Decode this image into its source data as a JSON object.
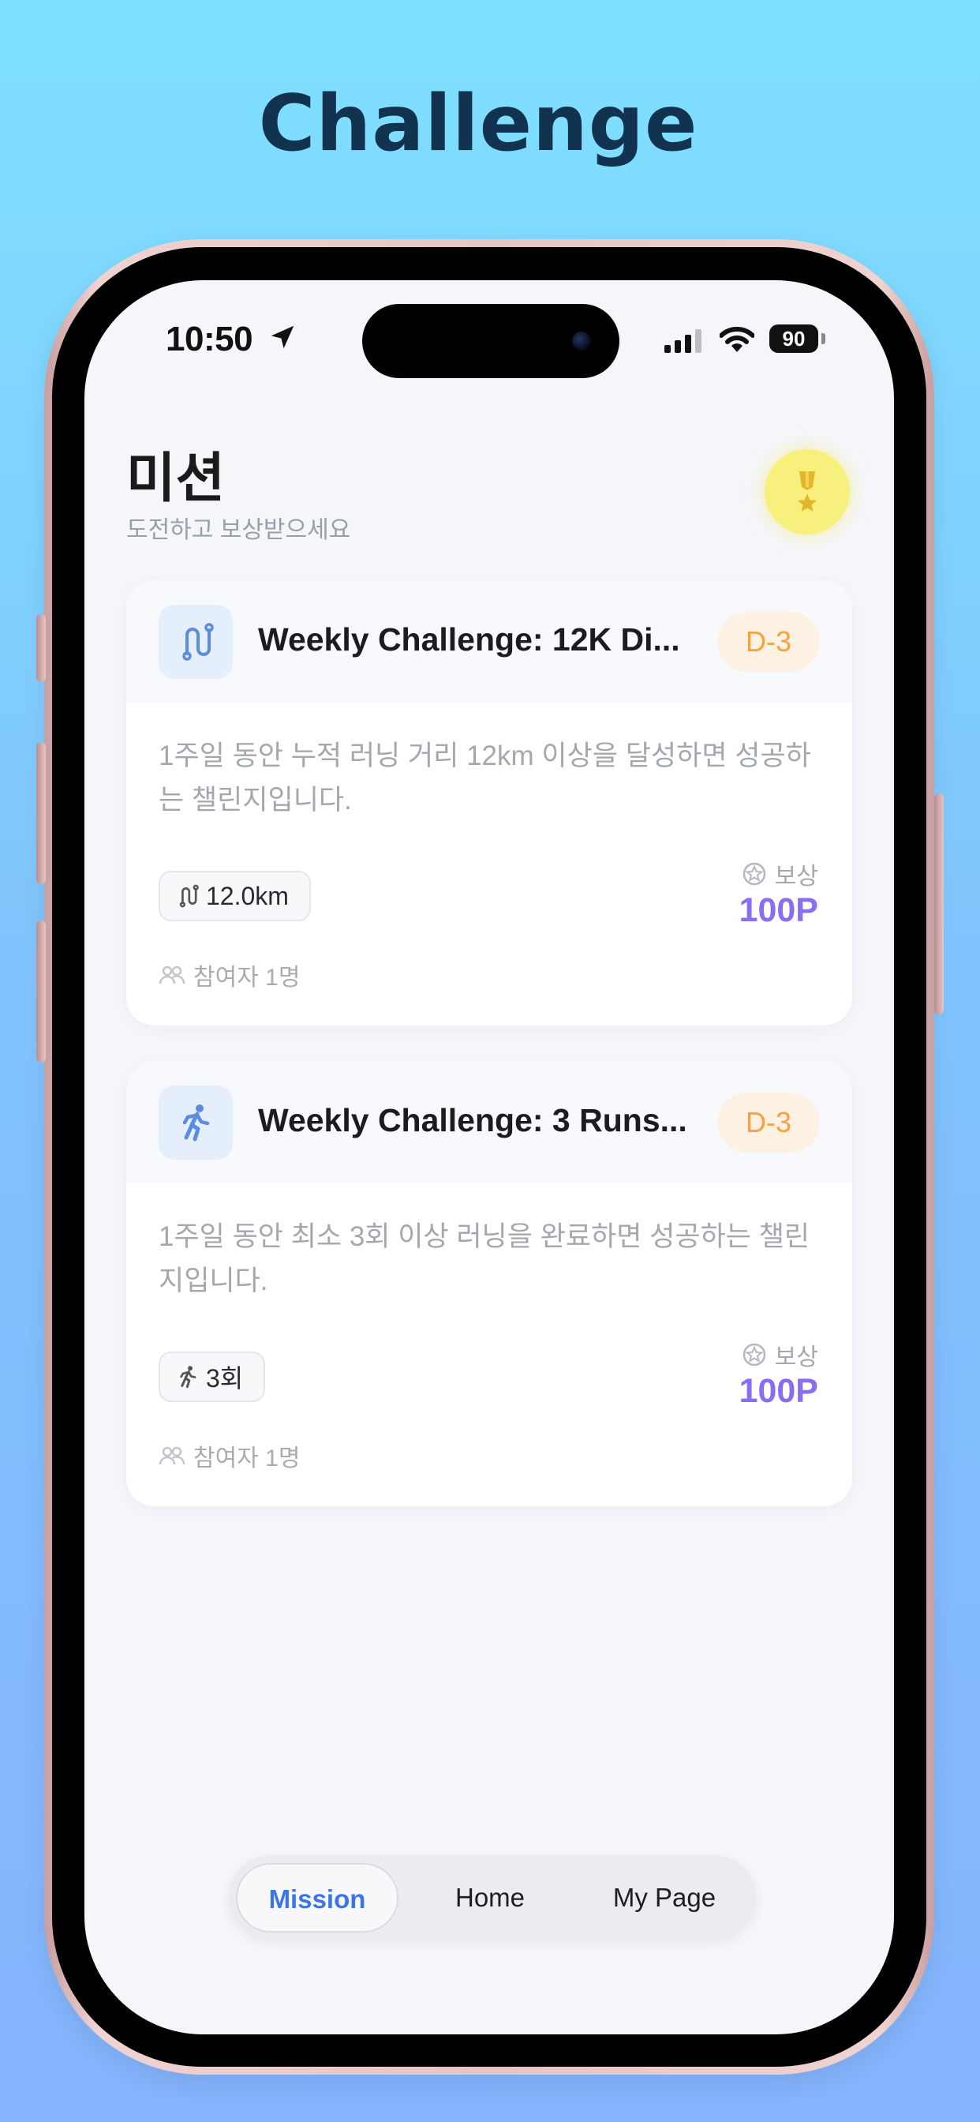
{
  "hero": {
    "title": "Challenge"
  },
  "status_bar": {
    "time": "10:50",
    "battery": "90"
  },
  "header": {
    "title": "미션",
    "subtitle": "도전하고 보상받으세요"
  },
  "cards": [
    {
      "icon": "route-icon",
      "title": "Weekly Challenge: 12K Di...",
      "badge": "D-3",
      "description": "1주일 동안 누적 러닝 거리 12km 이상을 달성하면 성공하는 챌린지입니다.",
      "stat": "12.0km",
      "reward_label": "보상",
      "reward_value": "100P",
      "participants": "참여자 1명"
    },
    {
      "icon": "runner-icon",
      "title": "Weekly Challenge: 3 Runs...",
      "badge": "D-3",
      "description": "1주일 동안 최소 3회 이상 러닝을 완료하면 성공하는 챌린지입니다.",
      "stat": "3회",
      "reward_label": "보상",
      "reward_value": "100P",
      "participants": "참여자 1명"
    }
  ],
  "tabs": [
    {
      "label": "Mission",
      "active": true
    },
    {
      "label": "Home",
      "active": false
    },
    {
      "label": "My Page",
      "active": false
    }
  ],
  "colors": {
    "accent": "#3a76e6",
    "reward": "#8a6df0",
    "badge_text": "#f6a23d",
    "badge_bg": "#fdf1e3",
    "medal_bg": "#f7f07c"
  }
}
